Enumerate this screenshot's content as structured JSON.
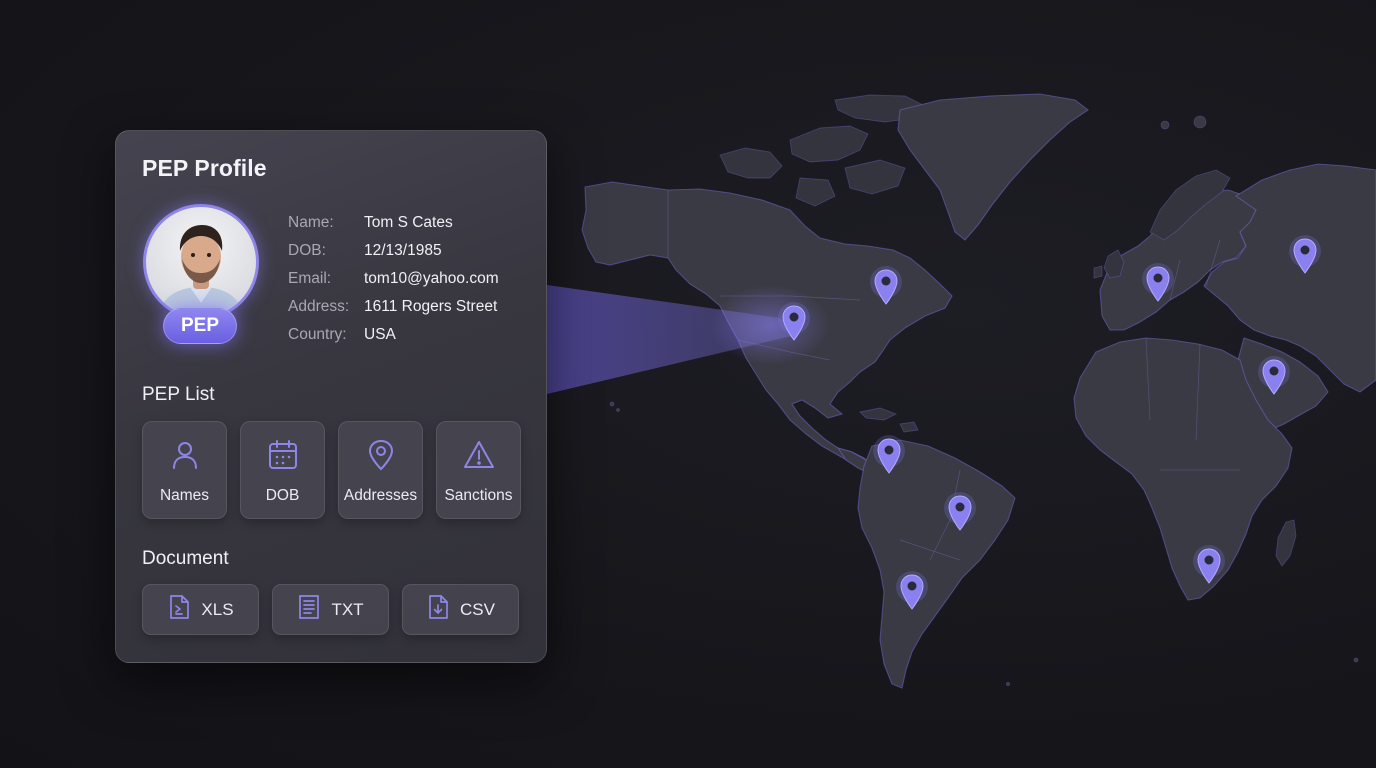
{
  "card": {
    "title": "PEP Profile",
    "badge": "PEP",
    "profile": [
      {
        "key": "Name:",
        "value": "Tom S Cates"
      },
      {
        "key": "DOB:",
        "value": "12/13/1985"
      },
      {
        "key": "Email:",
        "value": "tom10@yahoo.com"
      },
      {
        "key": "Address:",
        "value": "1611 Rogers Street"
      },
      {
        "key": "Country:",
        "value": "USA"
      }
    ],
    "list_title": "PEP List",
    "list": [
      {
        "label": "Names",
        "icon": "user-icon"
      },
      {
        "label": "DOB",
        "icon": "calendar-icon"
      },
      {
        "label": "Addresses",
        "icon": "location-pin-icon"
      },
      {
        "label": "Sanctions",
        "icon": "warning-icon"
      }
    ],
    "document_title": "Document",
    "documents": [
      {
        "label": "XLS",
        "icon": "xls-file-icon"
      },
      {
        "label": "TXT",
        "icon": "txt-file-icon"
      },
      {
        "label": "CSV",
        "icon": "csv-file-icon"
      }
    ]
  },
  "map": {
    "pins": [
      "north-america-usa",
      "north-america-canada",
      "south-america-colombia",
      "south-america-brazil",
      "south-america-argentina",
      "europe-germany",
      "asia-russia",
      "middle-east-arabia",
      "africa-south"
    ]
  },
  "colors": {
    "accent": "#7b72e6",
    "accent_glow": "#8d86e8",
    "background": "#16161b",
    "card": "#3c3b45",
    "land": "#3a3a44"
  }
}
